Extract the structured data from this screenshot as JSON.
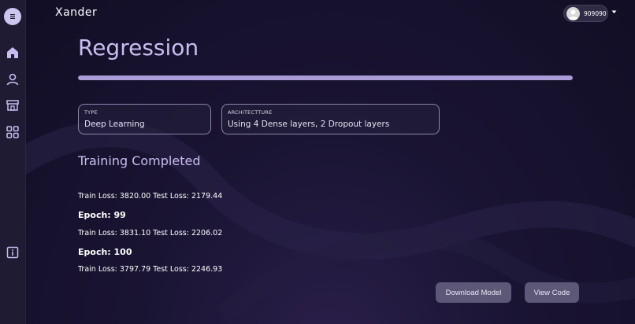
{
  "app": {
    "brand": "Xander"
  },
  "user": {
    "name": "909090"
  },
  "page": {
    "title": "Regression",
    "progress": 1.0
  },
  "fields": {
    "type": {
      "label": "TYPE",
      "value": "Deep Learning"
    },
    "architecture": {
      "label": "ARCHITECTTURE",
      "value": "Using 4 Dense layers, 2 Dropout layers"
    }
  },
  "status": "Training Completed",
  "logs": [
    {
      "kind": "loss",
      "text": "Train Loss: 3820.00 Test Loss: 2179.44"
    },
    {
      "kind": "epoch",
      "text": "Epoch: 99"
    },
    {
      "kind": "loss",
      "text": "Train Loss: 3831.10 Test Loss: 2206.02"
    },
    {
      "kind": "epoch",
      "text": "Epoch: 100"
    },
    {
      "kind": "loss",
      "text": "Train Loss: 3797.79 Test Loss: 2246.93"
    }
  ],
  "buttons": {
    "download": "Download Model",
    "view_code": "View Code"
  },
  "sidebar": {
    "icons": [
      "menu-icon",
      "home-icon",
      "user-icon",
      "store-icon",
      "grid-icon",
      "info-icon"
    ]
  },
  "colors": {
    "accent": "#c9bdf0",
    "progress": "#a99cd8",
    "button": "#5e5878",
    "background": "#14102a"
  }
}
